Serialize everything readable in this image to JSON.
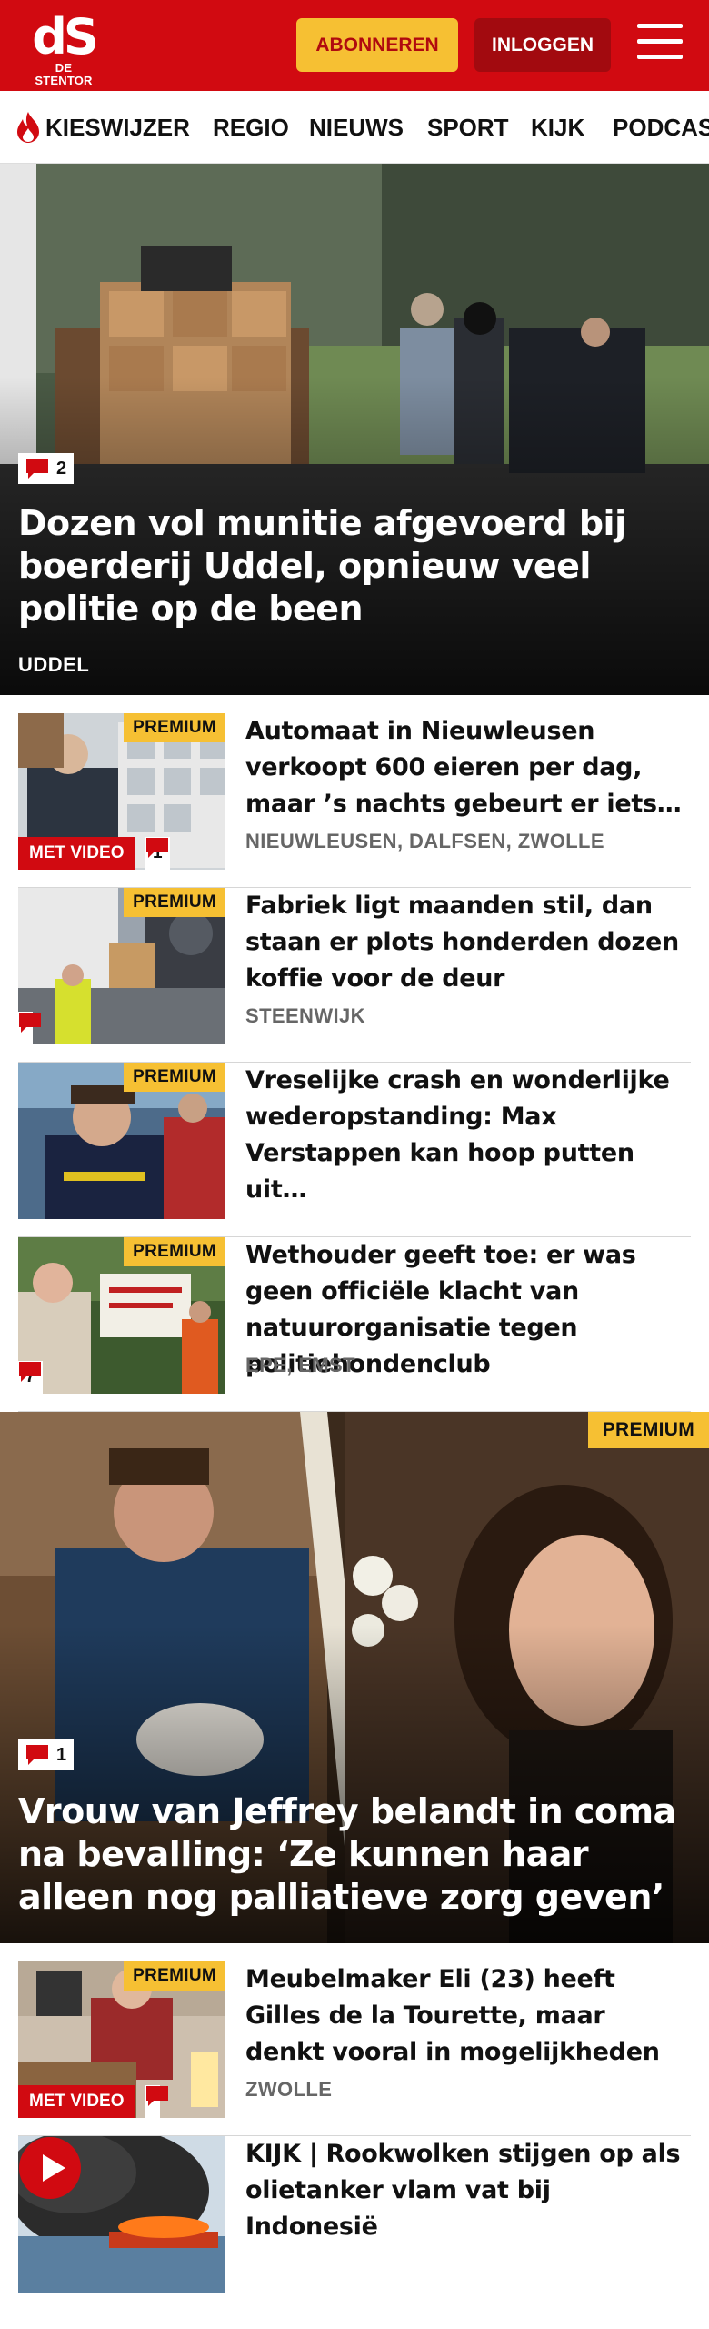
{
  "header": {
    "logo_mark": "dS",
    "logo_text": "DE STENTOR",
    "subscribe_label": "ABONNEREN",
    "login_label": "INLOGGEN",
    "brand_color": "#d10a11",
    "accent_color": "#f6c033"
  },
  "nav": {
    "items": [
      {
        "label": "KIESWIJZER",
        "icon": "flame-icon"
      },
      {
        "label": "REGIO"
      },
      {
        "label": "NIEUWS"
      },
      {
        "label": "SPORT"
      },
      {
        "label": "KIJK"
      },
      {
        "label": "PODCASTS"
      }
    ]
  },
  "hero": {
    "comments": "2",
    "title": "Dozen vol munitie afgevoerd bij boerderij Uddel, opnieuw veel politie op de been",
    "tag": "UDDEL"
  },
  "articles": [
    {
      "premium": "PREMIUM",
      "title": "Automaat in Nieuwleusen verkoopt 600 eieren per dag, maar ’s nachts gebeurt er iets…",
      "tag": "NIEUWLEUSEN, DALFSEN, ZWOLLE",
      "video_label": "MET VIDEO",
      "comments": "1"
    },
    {
      "premium": "PREMIUM",
      "title": "Fabriek ligt maanden stil, dan staan er plots honderden dozen koffie voor de deur",
      "tag": "STEENWIJK",
      "comments": ""
    },
    {
      "premium": "PREMIUM",
      "title": "Vreselijke crash en wonderlijke wederopstanding: Max Verstappen kan hoop putten uit…",
      "tag": ""
    },
    {
      "premium": "PREMIUM",
      "title": "Wethouder geeft toe: er was geen officiële klacht van natuurorga­nisatie tegen politiehondenclub",
      "tag": "EPE, EMST",
      "comments": "7"
    }
  ],
  "hero2": {
    "premium": "PREMIUM",
    "comments": "1",
    "title": "Vrouw van Jeffrey belandt in coma na bevalling: ‘Ze kunnen haar alleen nog palliatieve zorg geven’"
  },
  "articles2": [
    {
      "premium": "PREMIUM",
      "title": "Meubelmaker Eli (23) heeft Gilles de la Tourette, maar denkt vooral in mogelijkheden",
      "tag": "ZWOLLE",
      "video_label": "MET VIDEO",
      "comments": ""
    },
    {
      "title": "KIJK | Rookwolken stijgen op als olietanker vlam vat bij Indonesië",
      "tag": "",
      "icon": "play-icon"
    }
  ]
}
